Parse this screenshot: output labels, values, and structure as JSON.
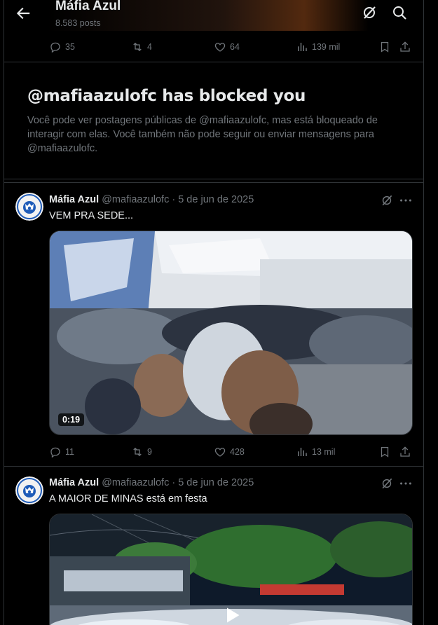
{
  "header": {
    "title": "Máfia Azul",
    "posts_count": "8.583 posts",
    "back_icon": "arrow-left-icon",
    "grok_icon": "grok-icon",
    "search_icon": "search-icon"
  },
  "top_actions": {
    "replies": "35",
    "reposts": "4",
    "likes": "64",
    "views": "139 mil"
  },
  "blocked": {
    "title": "@mafiaazulofc has blocked you",
    "body": "Você pode ver postagens públicas de @mafiaazulofc, mas está bloqueado de interagir com elas. Você também não pode seguir ou enviar mensagens para @mafiaazulofc."
  },
  "tweets": [
    {
      "name": "Máfia Azul",
      "handle": "@mafiaazulofc",
      "date": "· 5 de jun de 2025",
      "text": "VEM PRA SEDE...",
      "video_duration": "0:19",
      "replies": "11",
      "reposts": "9",
      "likes": "428",
      "views": "13 mil"
    },
    {
      "name": "Máfia Azul",
      "handle": "@mafiaazulofc",
      "date": "· 5 de jun de 2025",
      "text": "A MAIOR DE MINAS está em festa"
    }
  ],
  "colors": {
    "background": "#000000",
    "text_primary": "#e7e9ea",
    "text_secondary": "#71767b",
    "border": "#2f3336",
    "brand_blue": "#1e5bb8"
  }
}
